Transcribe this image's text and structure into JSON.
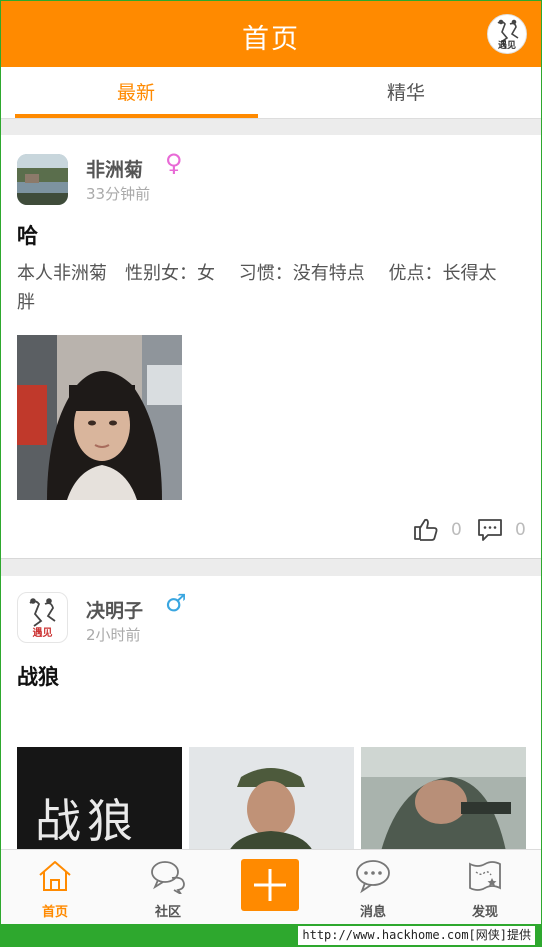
{
  "header": {
    "title": "首页",
    "logo_text": "遇见"
  },
  "tabs": [
    {
      "label": "最新",
      "active": true
    },
    {
      "label": "精华",
      "active": false
    }
  ],
  "posts": [
    {
      "username": "非洲菊",
      "gender_symbol": "♀",
      "gender_color": "#e86ad6",
      "time": "33分钟前",
      "title": "哈",
      "body": "本人非洲菊　性别女：女　 习惯：没有特点　 优点：长得太胖",
      "likes": "0",
      "comments": "0"
    },
    {
      "username": "决明子",
      "gender_symbol": "♂",
      "gender_color": "#3aa6e0",
      "time": "2小时前",
      "title": "战狼",
      "photo1_text": "战狼",
      "avatar_text": "遇见"
    }
  ],
  "bottom_nav": [
    {
      "label": "首页",
      "icon": "home-icon",
      "active": true
    },
    {
      "label": "社区",
      "icon": "community-chat-icon",
      "active": false
    },
    {
      "label": "",
      "icon": "plus-icon",
      "active": false
    },
    {
      "label": "消息",
      "icon": "message-bubble-icon",
      "active": false
    },
    {
      "label": "发现",
      "icon": "discover-map-icon",
      "active": false
    }
  ],
  "watermark": "http://www.hackhome.com[网侠]提供",
  "colors": {
    "accent": "#ff8a00",
    "watermark_bg": "#2ea82e"
  }
}
